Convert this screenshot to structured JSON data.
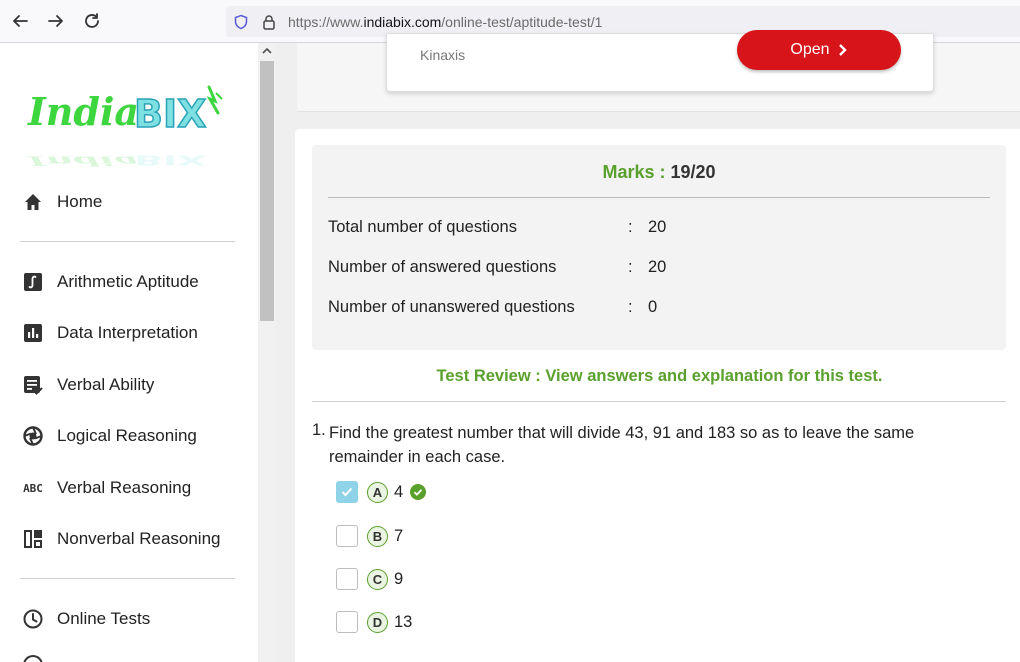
{
  "browser": {
    "url_prefix": "https://www.",
    "url_domain": "indiabix.com",
    "url_path": "/online-test/aptitude-test/1"
  },
  "sidebar": {
    "logo_text": "IndiaBIX",
    "items": [
      {
        "label": "Home",
        "icon": "home-icon"
      },
      {
        "label": "Arithmetic Aptitude",
        "icon": "integral-icon"
      },
      {
        "label": "Data Interpretation",
        "icon": "bar-chart-icon"
      },
      {
        "label": "Verbal Ability",
        "icon": "doc-check-icon"
      },
      {
        "label": "Logical Reasoning",
        "icon": "aperture-icon"
      },
      {
        "label": "Verbal Reasoning",
        "icon": "abc-icon",
        "icon_text": "ABC"
      },
      {
        "label": "Nonverbal Reasoning",
        "icon": "dashboard-icon"
      },
      {
        "label": "Online Tests",
        "icon": "clock-icon"
      }
    ]
  },
  "ad": {
    "brand": "Kinaxis",
    "button_label": "Open"
  },
  "score": {
    "marks_label": "Marks :",
    "marks_value": "19/20",
    "rows": [
      {
        "label": "Total number of questions",
        "sep": ":",
        "value": "20"
      },
      {
        "label": "Number of answered questions",
        "sep": ":",
        "value": "20"
      },
      {
        "label": "Number of unanswered questions",
        "sep": ":",
        "value": "0"
      }
    ]
  },
  "review_link": "Test Review : View answers and explanation for this test.",
  "question": {
    "number": "1.",
    "text": "Find the greatest number that will divide 43, 91 and 183 so as to leave the same remainder in each case.",
    "options": [
      {
        "letter": "A",
        "text": "4",
        "selected": true,
        "correct": true
      },
      {
        "letter": "B",
        "text": "7",
        "selected": false,
        "correct": false
      },
      {
        "letter": "C",
        "text": "9",
        "selected": false,
        "correct": false
      },
      {
        "letter": "D",
        "text": "13",
        "selected": false,
        "correct": false
      }
    ]
  },
  "colors": {
    "accent_green": "#5aa02c",
    "ad_red": "#d7141a",
    "checkbox_selected": "#8fd3e8"
  }
}
